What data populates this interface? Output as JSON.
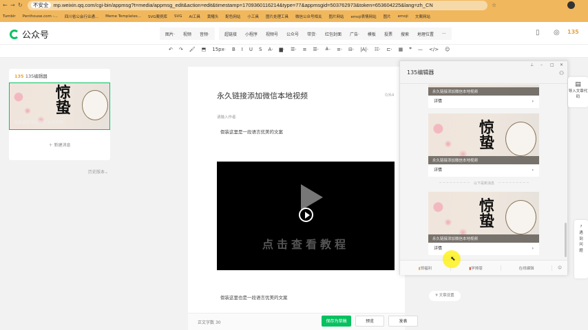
{
  "browser": {
    "security": "不安全",
    "url": "mp.weixin.qq.com/cgi-bin/appmsg?t=media/appmsg_edit&action=edit&timestamp=1709360116214&type=77&appmsgid=503762973&token=653604225&lang=zh_CN",
    "bookmarks": [
      "Tumblr",
      "Penthouse.com -...",
      "四川省公会行业通...",
      "Meme Templates...",
      "SVG案例库",
      "SVG",
      "AI工具",
      "黄鳝头",
      "配色网站",
      "小工具",
      "图片处理工具",
      "微信公众号相关",
      "图片网站",
      "emoji表情网站",
      "图片",
      "emoji",
      "文案网站"
    ]
  },
  "header": {
    "logo": "公众号",
    "menu1": [
      "图片·",
      "视频",
      "音频·"
    ],
    "menu2": [
      "超链接",
      "小程序",
      "视频号",
      "公众号",
      "带货·",
      "红包封面",
      "广告·",
      "模板",
      "投票",
      "搜索",
      "地理位置",
      "···"
    ]
  },
  "toolbar": {
    "items": [
      "↶",
      "↷",
      "🖌",
      "⬒",
      "15px·",
      "B",
      "I",
      "U",
      "S",
      "A·",
      "▆·",
      "☰·",
      "≡",
      "☰·",
      "≜·",
      "≡·",
      "⊟·",
      "|A|·",
      "☷·",
      "⊏·",
      "▦",
      "❞",
      "—",
      "</>",
      "☺"
    ]
  },
  "left_panel": {
    "source": "135编辑器",
    "article_caption": "永久链接添加微信本地视频",
    "new_message": "新建消息",
    "history": "历史版本"
  },
  "editor": {
    "title": "永久链接添加微信本地视频",
    "title_count": "0/64",
    "author_placeholder": "请输入作者",
    "para1": "假装这里是一段语言优美的文案",
    "video_text": "点击查看教程",
    "para2": "假装这里也是一段语言优美的文案",
    "word_count_label": "正文字数",
    "word_count": "30",
    "save": "保存为草稿",
    "preview": "预览",
    "publish": "发表",
    "settings": "文章设置"
  },
  "art_text": "惊蛰",
  "popup": {
    "title": "135编辑器",
    "cards": [
      {
        "caption": "永久链接添加微信本地视频",
        "detail": "详情"
      },
      {
        "caption": "永久链接添加微信本地视频",
        "detail": "详情"
      },
      {
        "caption": "永久链接添加微信本地视频",
        "detail": "详情"
      }
    ],
    "divider": "以下是新消息",
    "footer": [
      "领福利",
      "学排版",
      "在线编辑"
    ]
  },
  "side": {
    "import": "导入文章代码",
    "help": "遇到问题"
  },
  "colors": {
    "accent": "#07c160",
    "bookmark_bar": "#f1b75c"
  }
}
